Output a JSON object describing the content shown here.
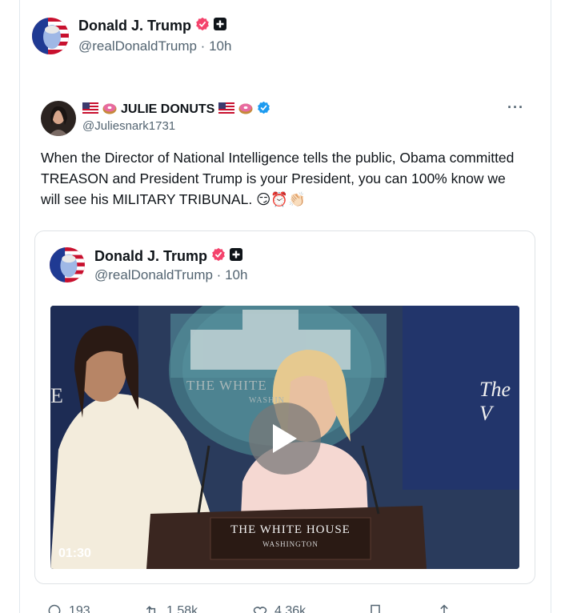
{
  "post": {
    "author_name": "Donald J. Trump",
    "author_handle": "@realDonaldTrump · 10h"
  },
  "quoted": {
    "author_name": "JULIE DONUTS",
    "author_handle": "@Juliesnark1731",
    "more_label": "···",
    "text": "When the Director of National Intelligence tells the public, Obama committed TREASON and President Trump is your President, you can 100% know we will see his MILITARY TRIBUNAL. 😏⏰👏🏻"
  },
  "embedded": {
    "author_name": "Donald J. Trump",
    "author_handle": "@realDonaldTrump · 10h",
    "video": {
      "duration": "01:30",
      "podium_line1": "THE WHITE HOUSE",
      "podium_line2": "WASHINGTON",
      "backdrop_text": "THE WHITE",
      "backdrop_subtext": "WASHIN",
      "screen_text": "The V",
      "left_letter": "E"
    }
  },
  "actions": {
    "replies": "193",
    "reposts": "1.58k",
    "likes": "4.36k"
  },
  "colors": {
    "verified_pink": "#f4436c",
    "verified_blue": "#1d9bf0",
    "muted": "#536471"
  }
}
